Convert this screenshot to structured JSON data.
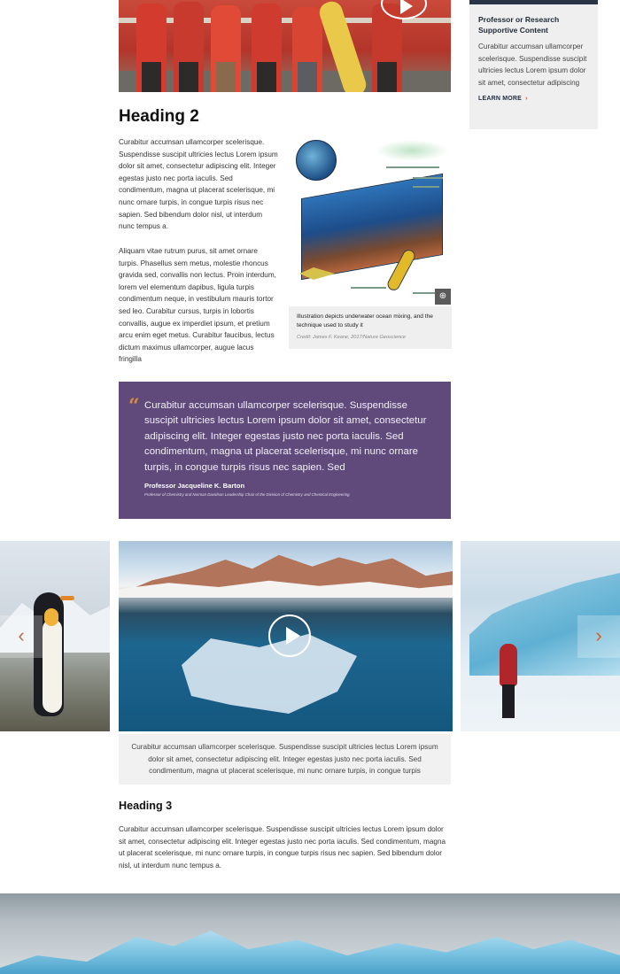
{
  "sidebar": {
    "title": "Professor or Research Supportive Content",
    "text": "Curabitur accumsan ullamcorper scelerisque. Suspendisse suscipit ultricies lectus Lorem ipsum dolor sit amet, consectetur adipiscing",
    "learn_more": "LEARN MORE",
    "learn_more_icon": "chevron-right-icon"
  },
  "hero": {
    "play_icon": "play-icon"
  },
  "article": {
    "heading2": "Heading 2",
    "para1": "Curabitur accumsan ullamcorper scelerisque. Suspendisse suscipit ultricies lectus Lorem ipsum dolor sit amet, consectetur adipiscing elit. Integer egestas justo nec porta iaculis. Sed condimentum, magna ut placerat scelerisque, mi nunc ornare turpis, in congue turpis risus nec sapien. Sed bibendum dolor nisl, ut interdum nunc tempus a.",
    "para2": "Aliquam vitae rutrum purus, sit amet ornare turpis. Phasellus sem metus, molestie rhoncus gravida sed, convallis non lectus. Proin interdum, lorem vel elementum dapibus, ligula turpis condimentum neque, in vestibulum mauris tortor sed leo. Curabitur cursus, turpis in lobortis convallis, augue ex imperdiet ipsum, et pretium arcu enim eget metus. Curabitur faucibus, lectus dictum maximus ullamcorper, augue lacus fringilla",
    "figure": {
      "caption": "Illustration depicts underwater ocean mixing, and the technique used to study it",
      "credit": "Credit: James F. Keane, 2017/Nature Geoscience",
      "zoom_icon": "zoom-in-icon"
    },
    "heading3": "Heading 3",
    "para3": "Curabitur accumsan ullamcorper scelerisque. Suspendisse suscipit ultricies lectus Lorem ipsum dolor sit amet, consectetur adipiscing elit. Integer egestas justo nec porta iaculis. Sed condimentum, magna ut placerat scelerisque, mi nunc ornare turpis, in congue turpis risus nec sapien. Sed bibendum dolor nisl, ut interdum nunc tempus a."
  },
  "quote": {
    "mark": "“",
    "text": "Curabitur accumsan ullamcorper scelerisque. Suspendisse suscipit ultricies lectus Lorem ipsum dolor sit amet, consectetur adipiscing elit. Integer egestas justo nec porta iaculis. Sed condimentum, magna ut placerat scelerisque, mi nunc ornare turpis, in congue turpis risus nec sapien. Sed",
    "author": "Professor Jacqueline K. Barton",
    "role": "Professor of Chemistry and Norman Davidson Leadership Chair of the Division of Chemistry and Chemical Engineering"
  },
  "carousel": {
    "prev_icon": "‹",
    "next_icon": "›",
    "play_icon": "play-icon",
    "caption": "Curabitur accumsan ullamcorper scelerisque. Suspendisse suscipit ultricies lectus Lorem ipsum dolor sit amet, consectetur adipiscing elit. Integer egestas justo nec porta iaculis. Sed condimentum, magna ut placerat scelerisque, mi nunc ornare turpis, in congue turpis"
  },
  "colors": {
    "accent": "#e05a24",
    "quote_bg": "#5f4a7b",
    "sidebar_bg": "#efefef",
    "navy": "#2a3447"
  }
}
